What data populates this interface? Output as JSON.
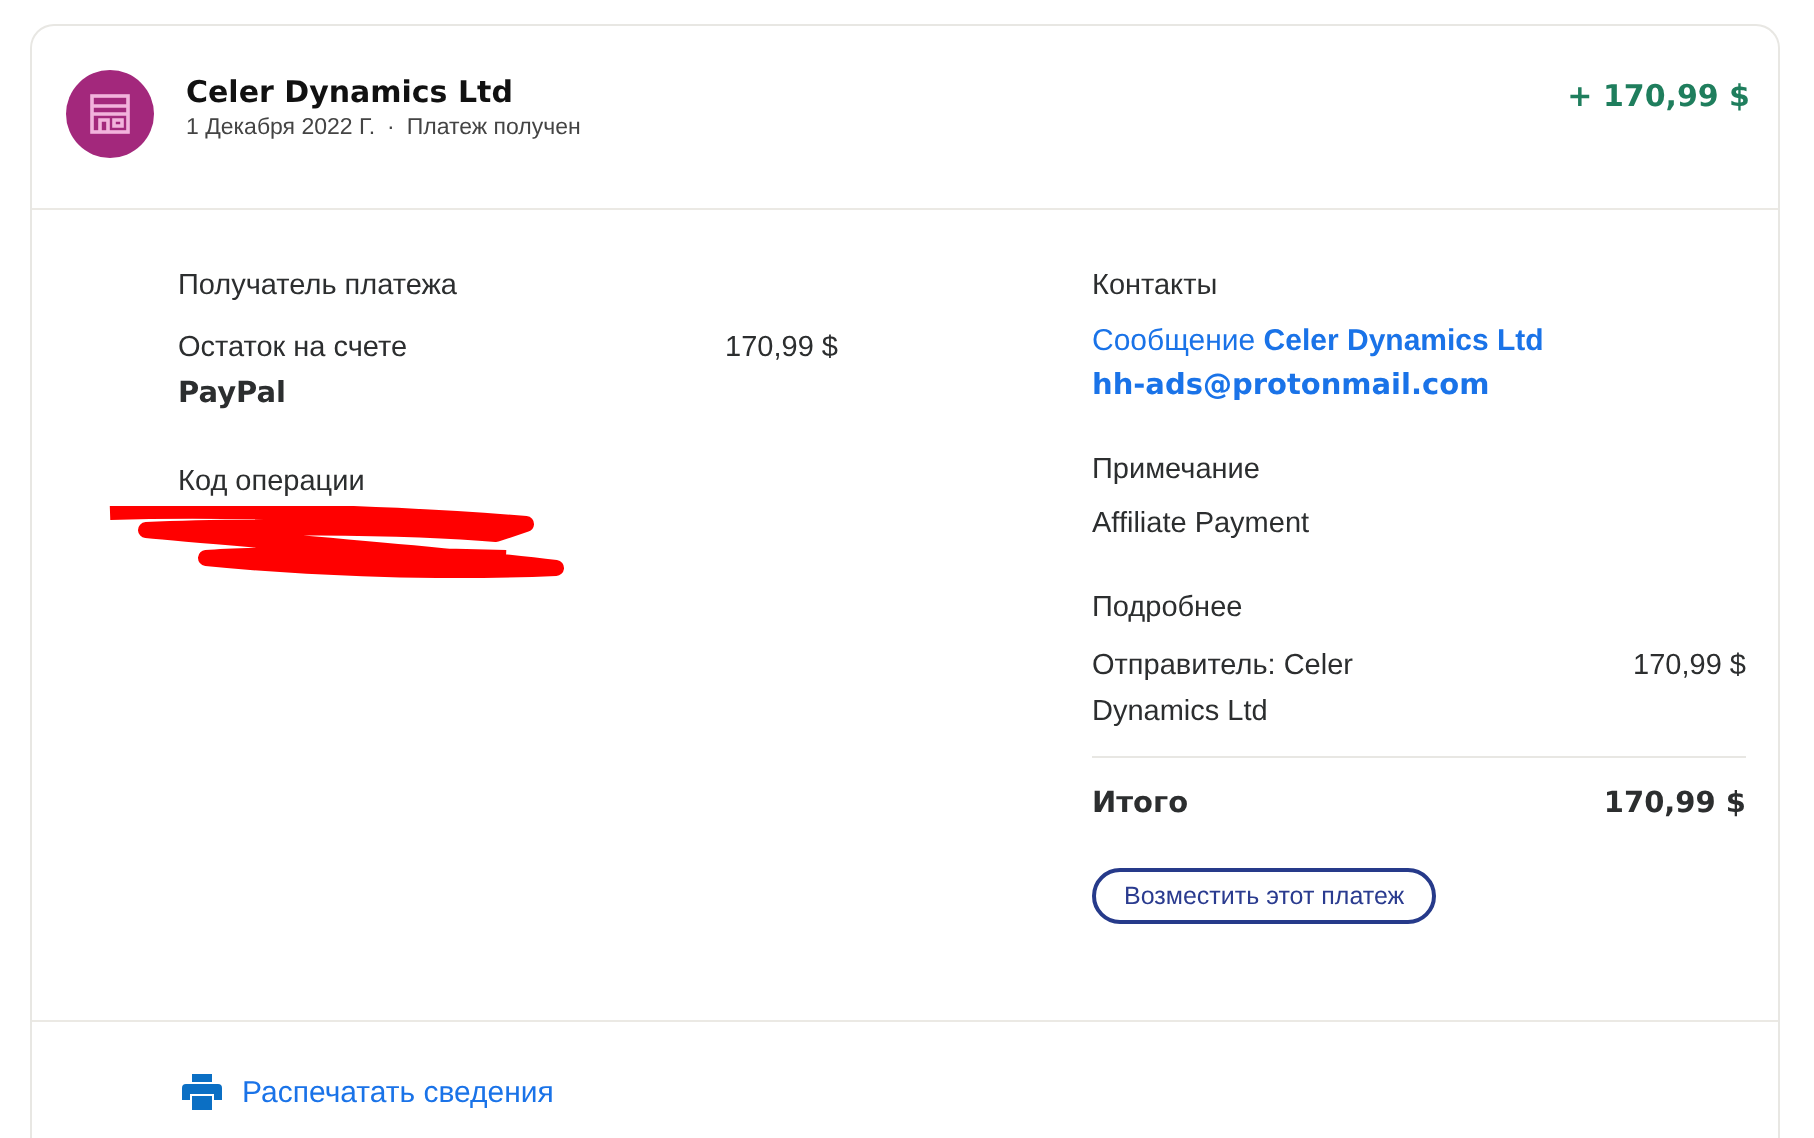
{
  "header": {
    "merchant": "Celer Dynamics Ltd",
    "date": "1 Декабря 2022 Г.",
    "separator": "·",
    "status": "Платеж получен",
    "amount": "+ 170,99 $"
  },
  "recipient": {
    "heading": "Получатель платежа",
    "line1": "Остаток на счете",
    "line2": "PayPal",
    "amount": "170,99 $"
  },
  "operation": {
    "heading": "Код операции"
  },
  "contacts": {
    "heading": "Контакты",
    "message_link": "Сообщение **Celer Dynamics Ltd**",
    "email": "hh-ads@protonmail.com"
  },
  "note": {
    "heading": "Примечание",
    "text": "Affiliate Payment"
  },
  "details": {
    "heading": "Подробнее",
    "sender": "Отправитель: Celer Dynamics Ltd",
    "sender_amount": "170,99 $",
    "total_label": "Итого",
    "total_amount": "170,99 $"
  },
  "refund_button": "Возместить этот платеж",
  "print_link": "Распечатать сведения"
}
